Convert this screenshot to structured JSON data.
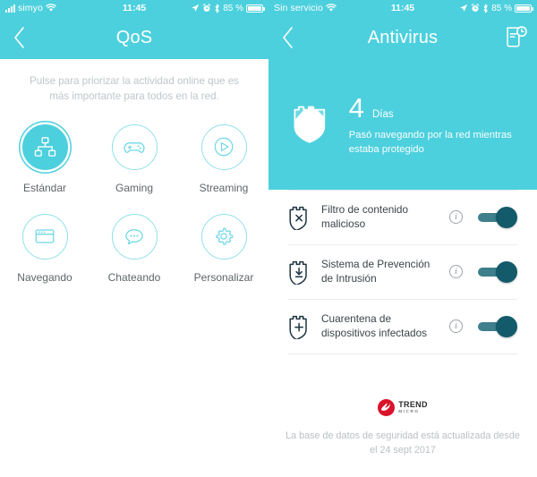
{
  "screens": {
    "qos": {
      "statusbar": {
        "carrier": "simyo",
        "wifi_icon": "wifi-icon",
        "time": "11:45",
        "location_icon": "location-arrow-icon",
        "alarm_icon": "alarm-clock-icon",
        "bluetooth_icon": "bluetooth-icon",
        "battery_percent": "85 %",
        "battery_icon": "battery-icon"
      },
      "navbar": {
        "back_icon": "chevron-left-icon",
        "title": "QoS"
      },
      "description": "Pulse para priorizar la actividad online que es más importante para todos en la red.",
      "modes": [
        {
          "label": "Estándar",
          "icon": "network-tree-icon",
          "selected": true
        },
        {
          "label": "Gaming",
          "icon": "gamepad-icon",
          "selected": false
        },
        {
          "label": "Streaming",
          "icon": "play-circle-icon",
          "selected": false
        },
        {
          "label": "Navegando",
          "icon": "browser-window-icon",
          "selected": false
        },
        {
          "label": "Chateando",
          "icon": "chat-bubble-icon",
          "selected": false
        },
        {
          "label": "Personalizar",
          "icon": "gear-icon",
          "selected": false
        }
      ]
    },
    "antivirus": {
      "statusbar": {
        "carrier": "Sin servicio",
        "wifi_icon": "wifi-icon",
        "time": "11:45",
        "location_icon": "location-arrow-icon",
        "alarm_icon": "alarm-clock-icon",
        "bluetooth_icon": "bluetooth-icon",
        "battery_percent": "85 %",
        "battery_icon": "battery-icon"
      },
      "navbar": {
        "back_icon": "chevron-left-icon",
        "title": "Antivirus",
        "report_icon": "report-history-icon"
      },
      "hero": {
        "shield_icon": "shield-check-icon",
        "days_value": "4",
        "days_unit": "Días",
        "subtitle": "Pasó navegando por la red mientras estaba protegido"
      },
      "settings": [
        {
          "icon": "shield-x-icon",
          "label": "Filtro de contenido malicioso",
          "info_icon": "info-icon",
          "toggle_on": true
        },
        {
          "icon": "shield-download-icon",
          "label": "Sistema de Prevención de Intrusión",
          "info_icon": "info-icon",
          "toggle_on": true
        },
        {
          "icon": "shield-plus-icon",
          "label": "Cuarentena de dispositivos infectados",
          "info_icon": "info-icon",
          "toggle_on": true
        }
      ],
      "footer": {
        "brand_line1": "TREND",
        "brand_line2": "MICRO",
        "note": "La base de datos de seguridad está actualizada desde el 24 sept 2017"
      }
    }
  },
  "colors": {
    "teal": "#4dd0dd",
    "icon_teal": "#6fd8e4",
    "toggle_on": "#135a6b",
    "shield_dark": "#1e3540",
    "brand_red": "#d8132a"
  }
}
